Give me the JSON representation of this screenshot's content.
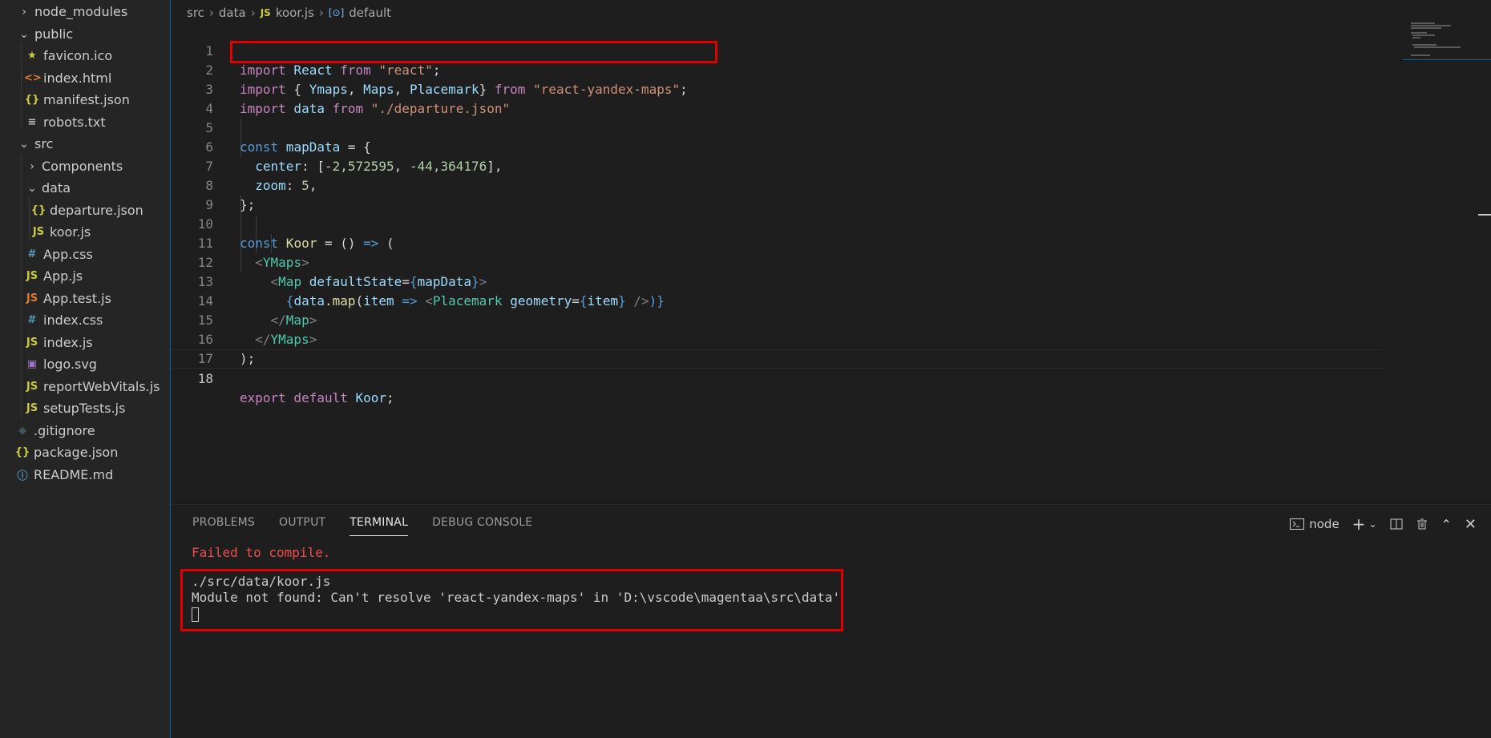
{
  "explorer": {
    "items": [
      {
        "label": "node_modules",
        "type": "folder-closed"
      },
      {
        "label": "public",
        "type": "folder-open"
      },
      {
        "label": "favicon.ico",
        "type": "ico"
      },
      {
        "label": "index.html",
        "type": "html"
      },
      {
        "label": "manifest.json",
        "type": "json"
      },
      {
        "label": "robots.txt",
        "type": "txt"
      },
      {
        "label": "src",
        "type": "folder-open"
      },
      {
        "label": "Components",
        "type": "folder-closed"
      },
      {
        "label": "data",
        "type": "folder-open"
      },
      {
        "label": "departure.json",
        "type": "json"
      },
      {
        "label": "koor.js",
        "type": "js"
      },
      {
        "label": "App.css",
        "type": "css"
      },
      {
        "label": "App.js",
        "type": "js"
      },
      {
        "label": "App.test.js",
        "type": "test-js"
      },
      {
        "label": "index.css",
        "type": "css"
      },
      {
        "label": "index.js",
        "type": "js"
      },
      {
        "label": "logo.svg",
        "type": "svg"
      },
      {
        "label": "reportWebVitals.js",
        "type": "js"
      },
      {
        "label": "setupTests.js",
        "type": "js"
      },
      {
        "label": ".gitignore",
        "type": "git"
      },
      {
        "label": "package.json",
        "type": "json"
      },
      {
        "label": "README.md",
        "type": "info"
      }
    ]
  },
  "breadcrumb": {
    "parts": [
      "src",
      "data",
      "koor.js",
      "default"
    ]
  },
  "code": {
    "line_numbers": [
      "1",
      "2",
      "3",
      "4",
      "5",
      "6",
      "7",
      "8",
      "9",
      "10",
      "11",
      "12",
      "13",
      "14",
      "15",
      "16",
      "17",
      "18"
    ],
    "tokens": {
      "l1": [
        "import",
        " React ",
        "from",
        " \"react\"",
        ";"
      ],
      "l2": [
        "import",
        " { ",
        "Ymaps",
        ", ",
        "Maps",
        ", ",
        "Placemark",
        "} ",
        "from",
        " \"react-yandex-maps\"",
        ";"
      ],
      "l3": [
        "import",
        " data ",
        "from",
        " \"./departure.json\""
      ],
      "l5": [
        "const",
        " mapData",
        " = {"
      ],
      "l6": [
        "center",
        ": [",
        "-2,572595",
        ", ",
        "-44,364176",
        "],"
      ],
      "l7": [
        "zoom",
        ": ",
        "5",
        ","
      ],
      "l8": [
        "};"
      ],
      "l10": [
        "const",
        " Koor",
        " = () ",
        "=>",
        " ("
      ],
      "l11": [
        "<",
        "YMaps",
        ">"
      ],
      "l12": [
        "<",
        "Map",
        " defaultState",
        "=",
        "{",
        "mapData",
        "}",
        ">"
      ],
      "l13": [
        "{",
        "data",
        ".",
        "map",
        "(",
        "item",
        " ",
        "=>",
        " <",
        "Placemark",
        " geometry",
        "=",
        "{",
        "item",
        "}",
        " />",
        ")}"
      ],
      "l14": [
        "</",
        "Map",
        ">"
      ],
      "l15": [
        "</",
        "YMaps",
        ">"
      ],
      "l16": [
        ");"
      ],
      "l18": [
        "export",
        " default",
        " Koor",
        ";"
      ]
    }
  },
  "panel": {
    "tabs": [
      "PROBLEMS",
      "OUTPUT",
      "TERMINAL",
      "DEBUG CONSOLE"
    ],
    "terminal_name": "node",
    "terminal": {
      "error_title": "Failed to compile.",
      "line1": "./src/data/koor.js",
      "line2": "Module not found: Can't resolve 'react-yandex-maps' in 'D:\\vscode\\magentaa\\src\\data'"
    }
  },
  "colors": {
    "highlight_box": "#e00000",
    "error_text": "#f14c4c",
    "keyword": "#c586c0",
    "string": "#ce9178"
  }
}
